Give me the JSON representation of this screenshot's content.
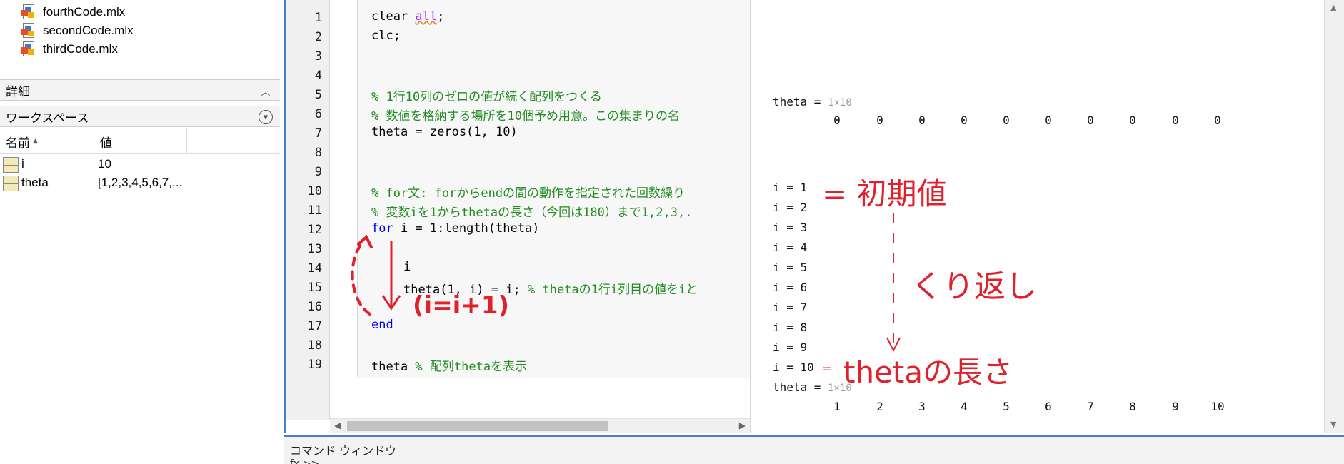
{
  "file_browser": {
    "files": [
      "fourthCode.mlx",
      "secondCode.mlx",
      "thirdCode.mlx"
    ]
  },
  "details_panel": {
    "title": "詳細"
  },
  "workspace": {
    "title": "ワークスペース",
    "columns": {
      "name": "名前",
      "value": "値"
    },
    "variables": [
      {
        "name": "i",
        "value": "10"
      },
      {
        "name": "theta",
        "value": "[1,2,3,4,5,6,7,..."
      }
    ]
  },
  "editor": {
    "line_numbers": [
      "1",
      "2",
      "3",
      "4",
      "5",
      "6",
      "7",
      "8",
      "9",
      "10",
      "11",
      "12",
      "13",
      "14",
      "15",
      "16",
      "17",
      "18",
      "19"
    ],
    "code": {
      "l1a": "clear ",
      "l1b": "all",
      "l1c": ";",
      "l2": "clc;",
      "l5": "% 1行10列のゼロの値が続く配列をつくる",
      "l6": "% 数値を格納する場所を10個予め用意。この集まりの名",
      "l7": "theta = zeros(1, 10)",
      "l10": "% for文: forからendの間の動作を指定された回数繰り",
      "l11": "% 変数iを1からthetaの長さ（今回は180）まで1,2,3,.",
      "l12a": "for",
      "l12b": " i = 1:length(theta)",
      "l14": "i",
      "l15a": "theta(1, i) = i; ",
      "l15b": "% thetaの1行i列目の値をiと",
      "l17": "end",
      "l19a": "theta ",
      "l19b": "% 配列thetaを表示"
    }
  },
  "output": {
    "theta_label": "theta = ",
    "dims": "1×10",
    "zeros": [
      "0",
      "0",
      "0",
      "0",
      "0",
      "0",
      "0",
      "0",
      "0",
      "0"
    ],
    "i_lines": [
      "i = 1",
      "i = 2",
      "i = 3",
      "i = 4",
      "i = 5",
      "i = 6",
      "i = 7",
      "i = 8",
      "i = 9",
      "i = 10"
    ],
    "values": [
      "1",
      "2",
      "3",
      "4",
      "5",
      "6",
      "7",
      "8",
      "9",
      "10"
    ]
  },
  "annotations": {
    "initial": "= 初期値",
    "repeat": "くり返し",
    "length": "thetaの長さ",
    "increment": "(i=i+1)"
  },
  "command_window": {
    "title": "コマンド ウィンドウ",
    "prompt": "fx >>"
  },
  "colors": {
    "accent": "#4a7fc1",
    "annotation": "#e0202a",
    "comment": "#228b22",
    "keyword": "#0000ff",
    "string": "#a020f0"
  }
}
